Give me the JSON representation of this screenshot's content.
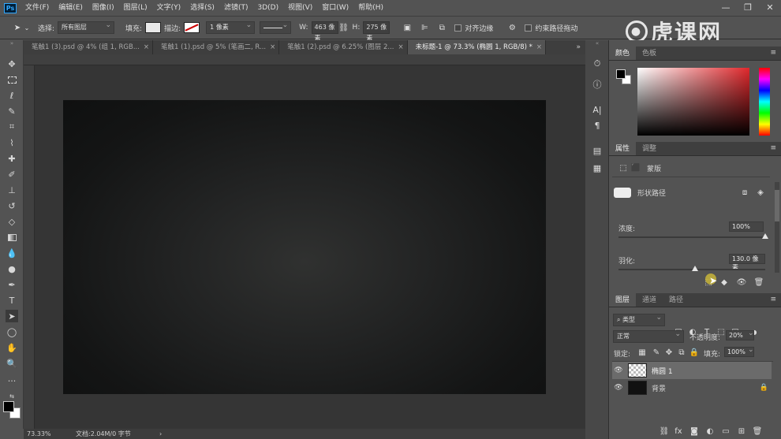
{
  "app": {
    "logo": "Ps"
  },
  "menu": [
    "文件(F)",
    "编辑(E)",
    "图像(I)",
    "图层(L)",
    "文字(Y)",
    "选择(S)",
    "滤镜(T)",
    "3D(D)",
    "视图(V)",
    "窗口(W)",
    "帮助(H)"
  ],
  "window_controls": {
    "minimize": "—",
    "restore": "❐",
    "close": "✕"
  },
  "options": {
    "select_label": "选择:",
    "select_value": "所有图层",
    "fill_label": "填充:",
    "stroke_label": "描边:",
    "stroke_width": "1 像素",
    "w_label": "W:",
    "w_value": "463 像素",
    "h_label": "H:",
    "h_value": "275 像素",
    "align_edges": "对齐边缘",
    "constrain": "约束路径拖动"
  },
  "tabs": [
    {
      "label": "笔触1 (3).psd @ 4% (组 1, RGB...",
      "active": false
    },
    {
      "label": "笔触1 (1).psd @ 5% (笔画二, R...",
      "active": false
    },
    {
      "label": "笔触1 (2).psd @ 6.25% (图层 2...",
      "active": false
    },
    {
      "label": "未标题-1 @ 73.3% (椭圆 1, RGB/8) *",
      "active": true
    }
  ],
  "tab_close": "×",
  "tab_overflow": "»",
  "status": {
    "zoom": "73.33%",
    "doc_info": "文档:2.04M/0 字节",
    "arrow": "›"
  },
  "color_panel": {
    "tab_color": "颜色",
    "tab_swatches": "色板"
  },
  "properties_panel": {
    "tab_properties": "属性",
    "tab_adjust": "调整",
    "mask_label": "蒙版",
    "shape_path": "形状路径",
    "density_label": "浓度:",
    "density_value": "100%",
    "density_fraction": 1.0,
    "feather_label": "羽化:",
    "feather_value": "130.0 像素",
    "feather_fraction": 0.52
  },
  "layers_panel": {
    "tab_layers": "图层",
    "tab_channels": "通道",
    "tab_paths": "路径",
    "filter_type": "类型",
    "blend_mode": "正常",
    "opacity_label": "不透明度:",
    "opacity_value": "20%",
    "lock_label": "锁定:",
    "fill_label": "填充:",
    "fill_value": "100%",
    "layers": [
      {
        "name": "椭圆 1",
        "selected": true
      },
      {
        "name": "背景",
        "selected": false
      }
    ]
  },
  "watermark": "虎课网",
  "colors": {
    "accent_fg": "#000000",
    "accent_bg": "#ffffff",
    "hue_base": "#e0282c"
  }
}
